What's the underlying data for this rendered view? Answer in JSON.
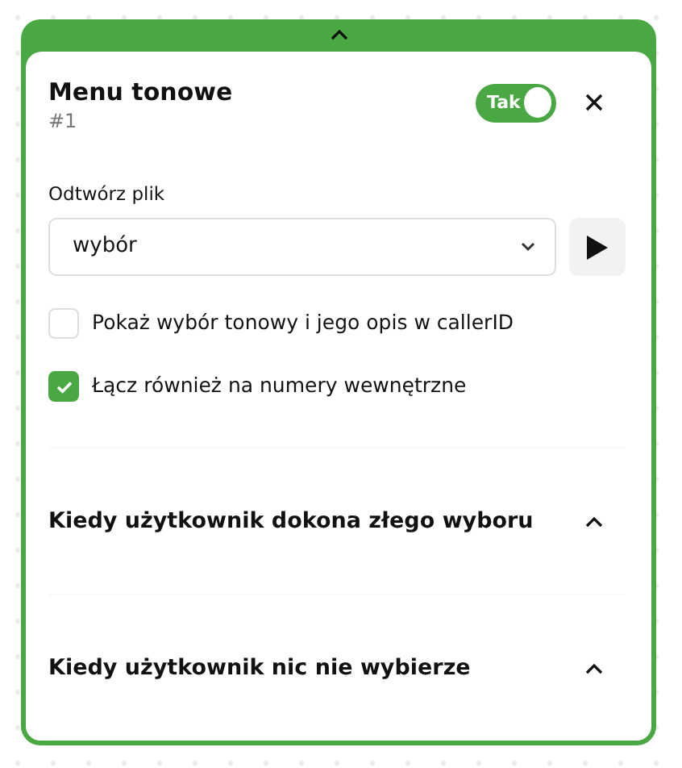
{
  "panel": {
    "title": "Menu tonowe",
    "subtitle": "#1",
    "toggle": {
      "label": "Tak",
      "on": true
    }
  },
  "file": {
    "label": "Odtwórz plik",
    "value": "wybór"
  },
  "options": [
    {
      "label": "Pokaż wybór tonowy i jego opis w callerID",
      "checked": false
    },
    {
      "label": "Łącz również na numery wewnętrzne",
      "checked": true
    }
  ],
  "sections": [
    {
      "title": "Kiedy użytkownik dokona złego wyboru"
    },
    {
      "title": "Kiedy użytkownik nic nie wybierze"
    }
  ]
}
